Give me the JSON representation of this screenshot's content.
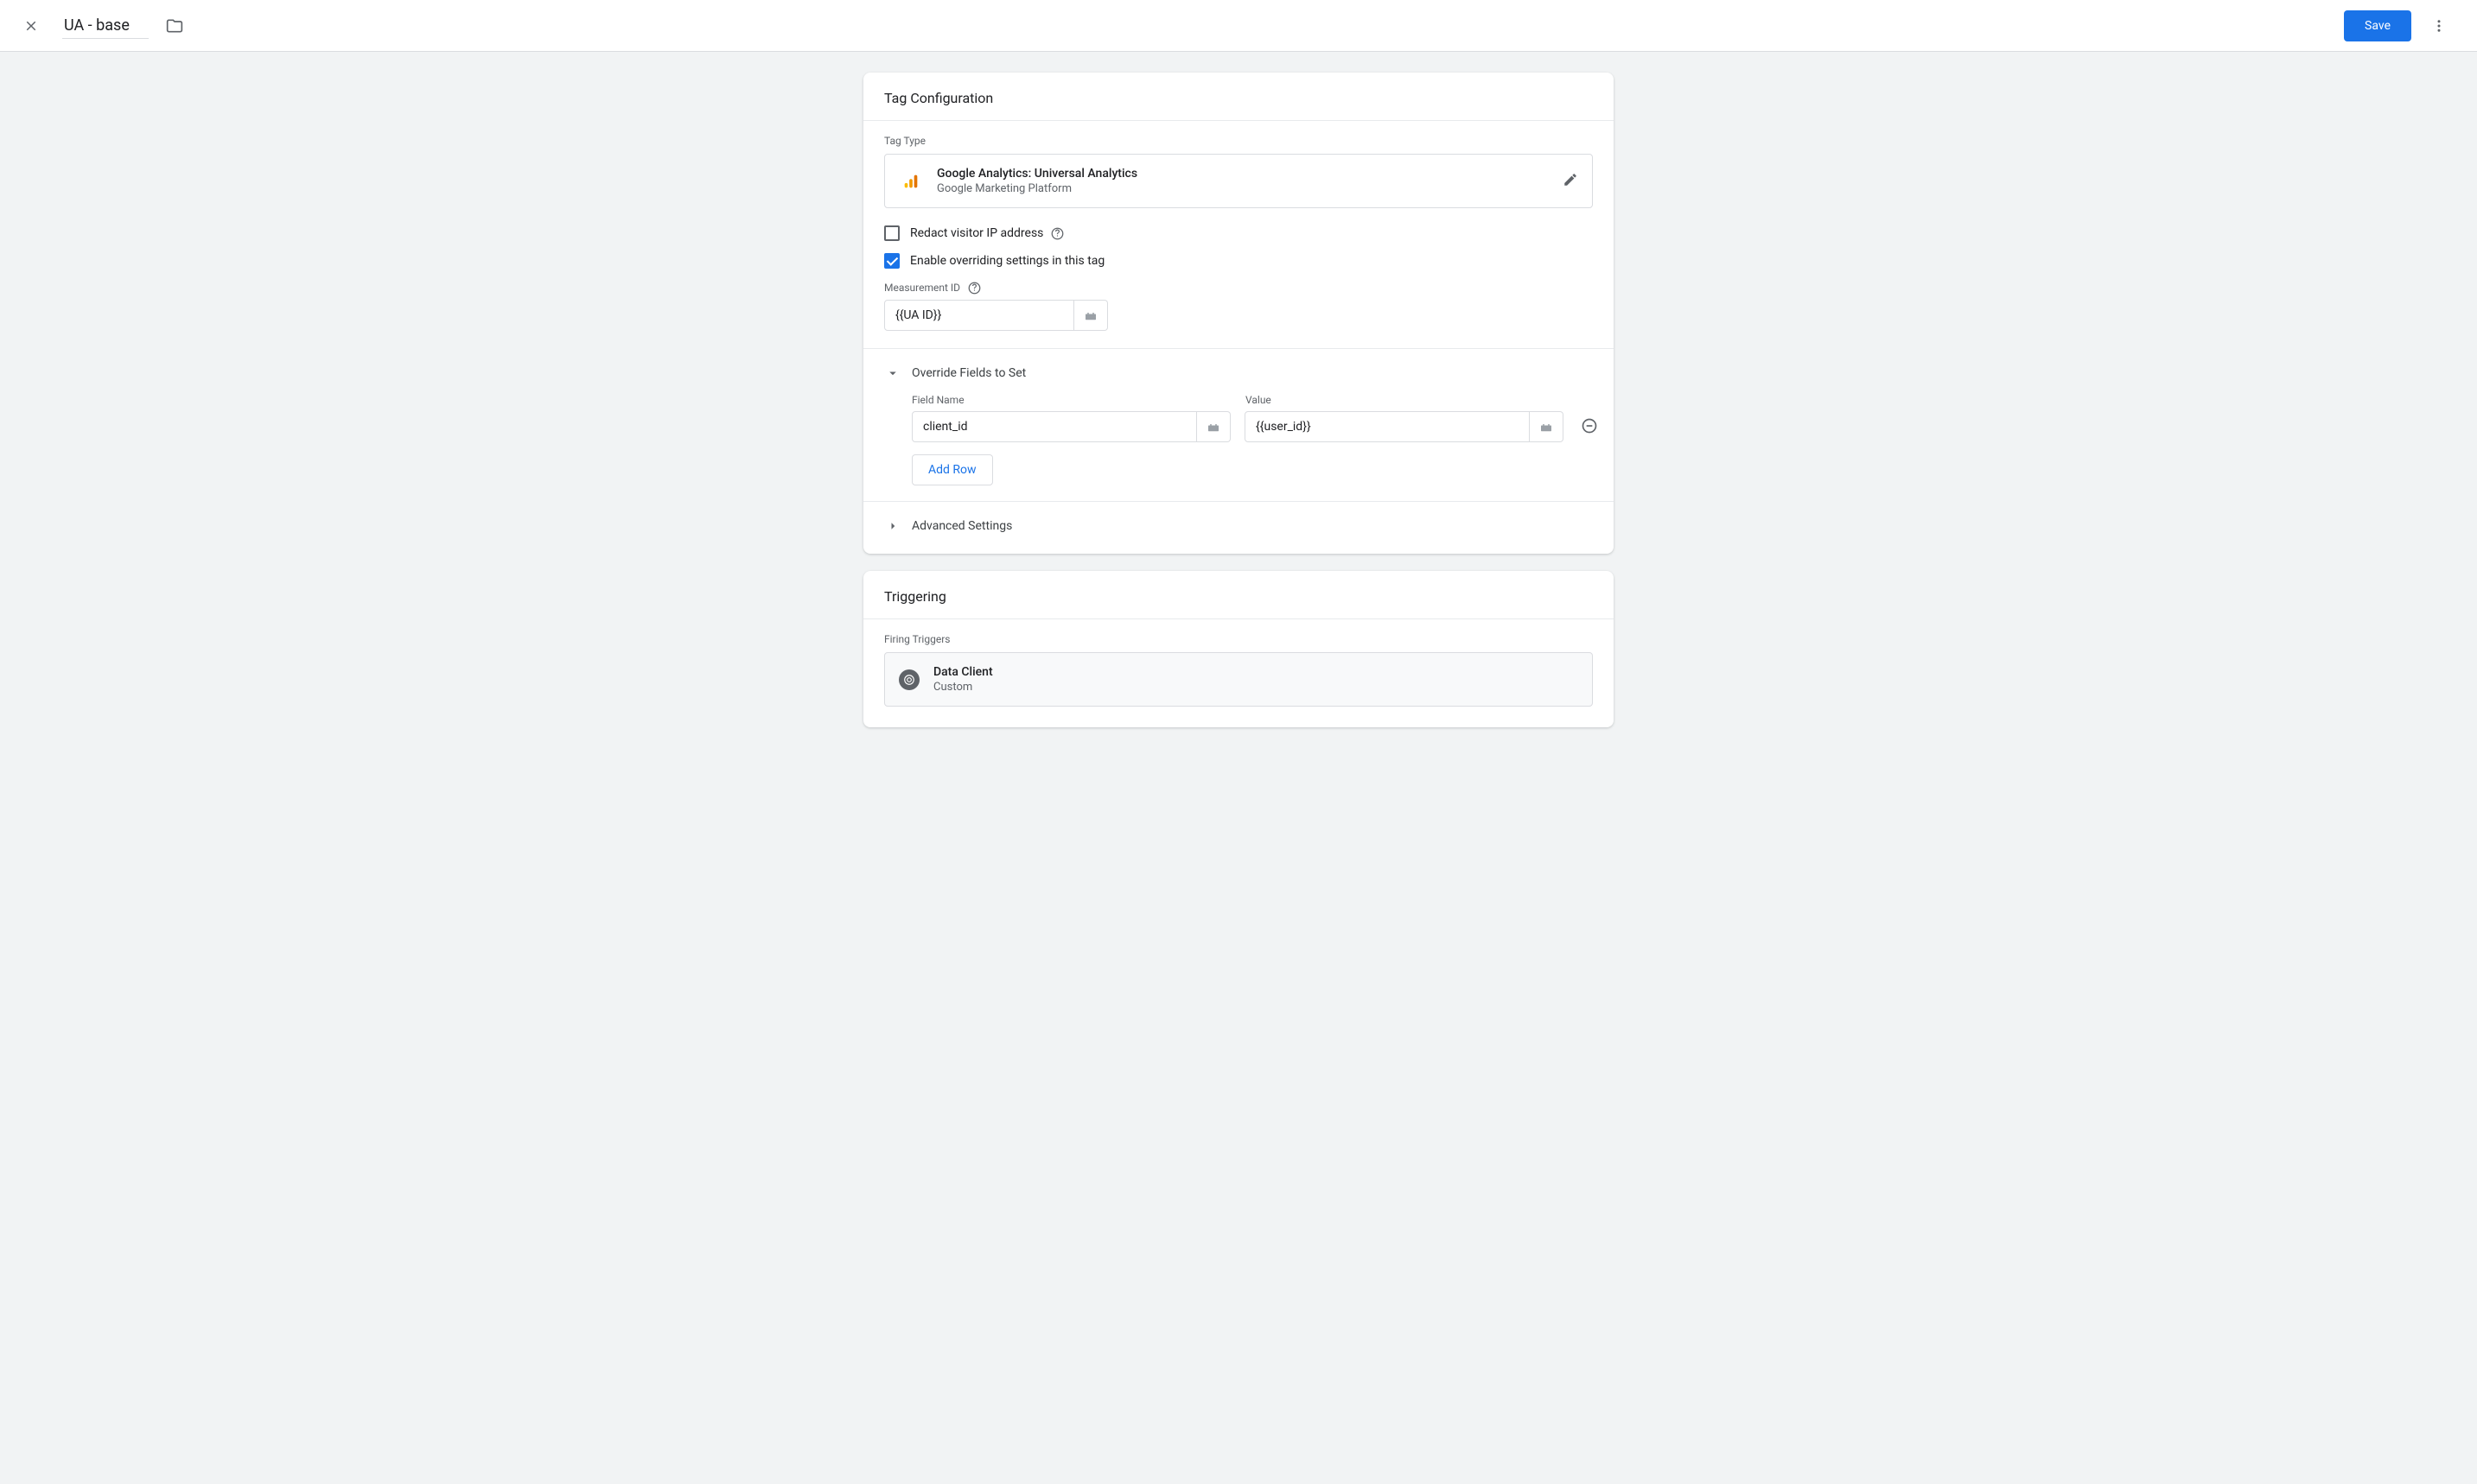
{
  "header": {
    "title": "UA - base",
    "save_label": "Save"
  },
  "tag_config": {
    "title": "Tag Configuration",
    "tag_type_label": "Tag Type",
    "tag_type_name": "Google Analytics: Universal Analytics",
    "tag_type_sub": "Google Marketing Platform",
    "redact_ip_label": "Redact visitor IP address",
    "redact_ip_checked": false,
    "override_settings_label": "Enable overriding settings in this tag",
    "override_settings_checked": true,
    "measurement_id_label": "Measurement ID",
    "measurement_id_value": "{{UA ID}}",
    "override_fields": {
      "title": "Override Fields to Set",
      "field_name_header": "Field Name",
      "value_header": "Value",
      "rows": [
        {
          "name": "client_id",
          "value": "{{user_id}}"
        }
      ],
      "add_row_label": "Add Row"
    },
    "advanced_settings_label": "Advanced Settings"
  },
  "triggering": {
    "title": "Triggering",
    "firing_triggers_label": "Firing Triggers",
    "triggers": [
      {
        "name": "Data Client",
        "type": "Custom"
      }
    ]
  }
}
